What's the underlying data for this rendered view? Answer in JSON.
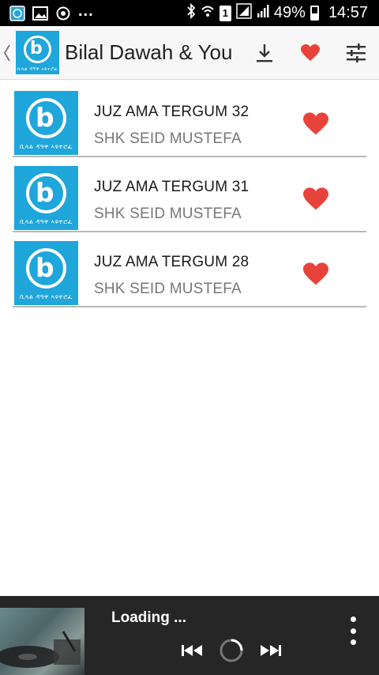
{
  "status_bar": {
    "left_icons": [
      "app-notification-icon",
      "image-icon",
      "sync-icon"
    ],
    "overflow": "...",
    "battery": "49%",
    "time": "14:57",
    "sim": "1"
  },
  "app_bar": {
    "title": "Bilal Dawah & You",
    "logo_caption": "ቢላል ዳዓዋ ኣዩተሮፈ",
    "actions": [
      "download-icon",
      "heart-icon",
      "equalizer-icon"
    ]
  },
  "tracks": [
    {
      "title": "JUZ AMA TERGUM 32",
      "artist": "SHK SEID MUSTEFA",
      "favorite": true
    },
    {
      "title": "JUZ AMA TERGUM 31",
      "artist": "SHK SEID MUSTEFA",
      "favorite": true
    },
    {
      "title": "JUZ AMA TERGUM 28",
      "artist": "SHK SEID MUSTEFA",
      "favorite": true
    }
  ],
  "player": {
    "status": "Loading ...",
    "controls": [
      "previous-icon",
      "loading-spinner",
      "next-icon",
      "more-icon"
    ]
  },
  "colors": {
    "accent": "#1fa6db",
    "heart": "#e8433a",
    "player_bg": "#262626"
  }
}
